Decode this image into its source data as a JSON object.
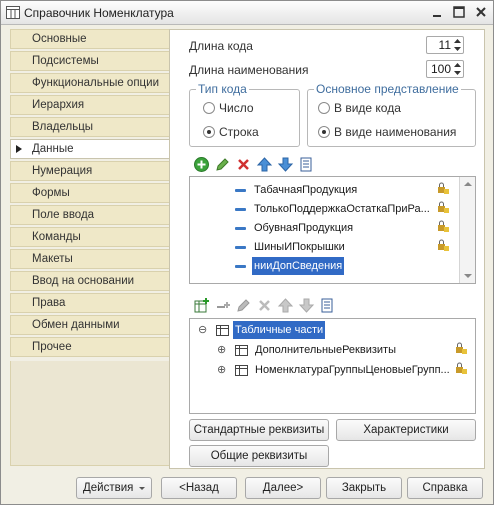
{
  "window": {
    "title": "Справочник Номенклатура"
  },
  "nav": {
    "items": [
      {
        "label": "Основные",
        "active": false
      },
      {
        "label": "Подсистемы",
        "active": false
      },
      {
        "label": "Функциональные опции",
        "active": false
      },
      {
        "label": "Иерархия",
        "active": false
      },
      {
        "label": "Владельцы",
        "active": false
      },
      {
        "label": "Данные",
        "active": true
      },
      {
        "label": "Нумерация",
        "active": false
      },
      {
        "label": "Формы",
        "active": false
      },
      {
        "label": "Поле ввода",
        "active": false
      },
      {
        "label": "Команды",
        "active": false
      },
      {
        "label": "Макеты",
        "active": false
      },
      {
        "label": "Ввод на основании",
        "active": false
      },
      {
        "label": "Права",
        "active": false
      },
      {
        "label": "Обмен данными",
        "active": false
      },
      {
        "label": "Прочее",
        "active": false
      }
    ]
  },
  "data_tab": {
    "code_length_label": "Длина кода",
    "code_length_value": "11",
    "name_length_label": "Длина наименования",
    "name_length_value": "100",
    "code_type": {
      "title": "Тип кода",
      "options": [
        "Число",
        "Строка"
      ],
      "selected": "Строка"
    },
    "main_representation": {
      "title": "Основное представление",
      "options": [
        "В виде кода",
        "В виде наименования"
      ],
      "selected": "В виде наименования"
    },
    "attributes": [
      {
        "name": "ТабачнаяПродукция",
        "locked": true
      },
      {
        "name": "ТолькоПоддержкаОстаткаПриРа...",
        "locked": true
      },
      {
        "name": "ОбувнаяПродукция",
        "locked": true
      },
      {
        "name": "ШиныИПокрышки",
        "locked": true
      },
      {
        "name": "нииДопСведения",
        "locked": false,
        "selected": true
      }
    ],
    "tabular_root": "Табличные части",
    "tabular_sections": [
      {
        "name": "ДополнительныеРеквизиты",
        "locked": true
      },
      {
        "name": "НоменклатураГруппыЦеновыеГрупп...",
        "locked": true
      }
    ],
    "buttons": {
      "standard_attributes": "Стандартные реквизиты",
      "characteristics": "Характеристики",
      "common_attributes": "Общие реквизиты"
    }
  },
  "footer": {
    "actions": "Действия",
    "back": "<Назад",
    "next": "Далее>",
    "close": "Закрыть",
    "help": "Справка"
  },
  "colors": {
    "accent": "#316ac5",
    "nav_bg": "#efe8c8",
    "group_title": "#3f6d9e"
  }
}
